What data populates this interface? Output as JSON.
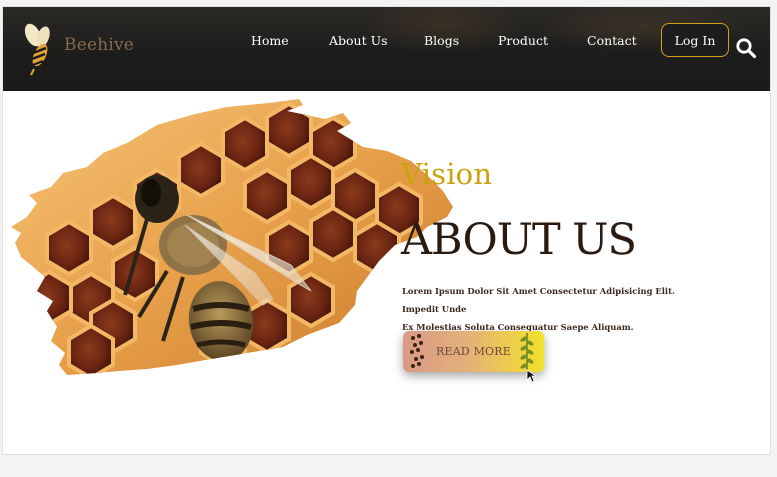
{
  "header": {
    "brand": "Beehive",
    "nav": {
      "home": "Home",
      "about": "About Us",
      "blogs": "Blogs",
      "product": "Product",
      "contact": "Contact"
    },
    "login_label": "Log In",
    "search_icon": "search-icon"
  },
  "hero": {
    "subtitle": "Vision",
    "title": "ABOUT US",
    "description_line1": "Lorem Ipsum Dolor Sit Amet Consectetur Adipisicing Elit. Impedit Unde",
    "description_line2": "Ex Molestias Soluta Consequatur Saepe Aliquam.",
    "button_label": "READ MORE"
  },
  "colors": {
    "header_bg": "#1c1c1c",
    "accent_gold": "#c9a20c",
    "login_border": "#d4a017",
    "title_dark": "#2a1a10",
    "brand_brown": "#8a6a4d"
  }
}
